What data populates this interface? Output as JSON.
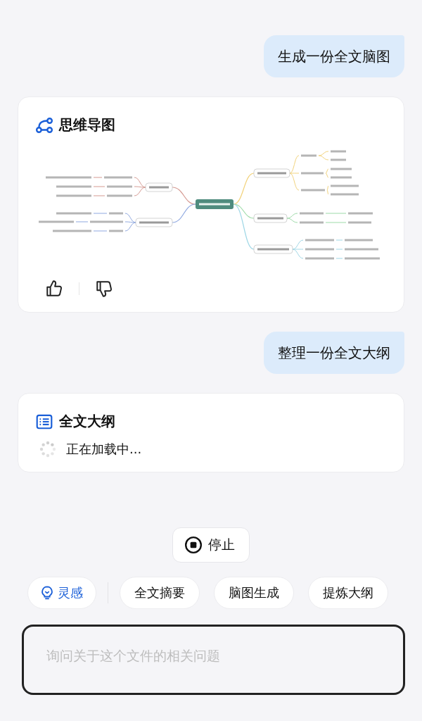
{
  "messages": [
    {
      "kind": "user",
      "text": "生成一份全文脑图"
    },
    {
      "kind": "mindmap",
      "title": "思维导图"
    },
    {
      "kind": "user",
      "text": "整理一份全文大纲"
    },
    {
      "kind": "outline",
      "title": "全文大纲",
      "status": "正在加载中..."
    }
  ],
  "stop_button": "停止",
  "chips": [
    {
      "label": "灵感",
      "kind": "accent"
    },
    {
      "label": "全文摘要",
      "kind": "plain"
    },
    {
      "label": "脑图生成",
      "kind": "plain"
    },
    {
      "label": "提炼大纲",
      "kind": "plain"
    }
  ],
  "input": {
    "placeholder": "询问关于这个文件的相关问题"
  }
}
